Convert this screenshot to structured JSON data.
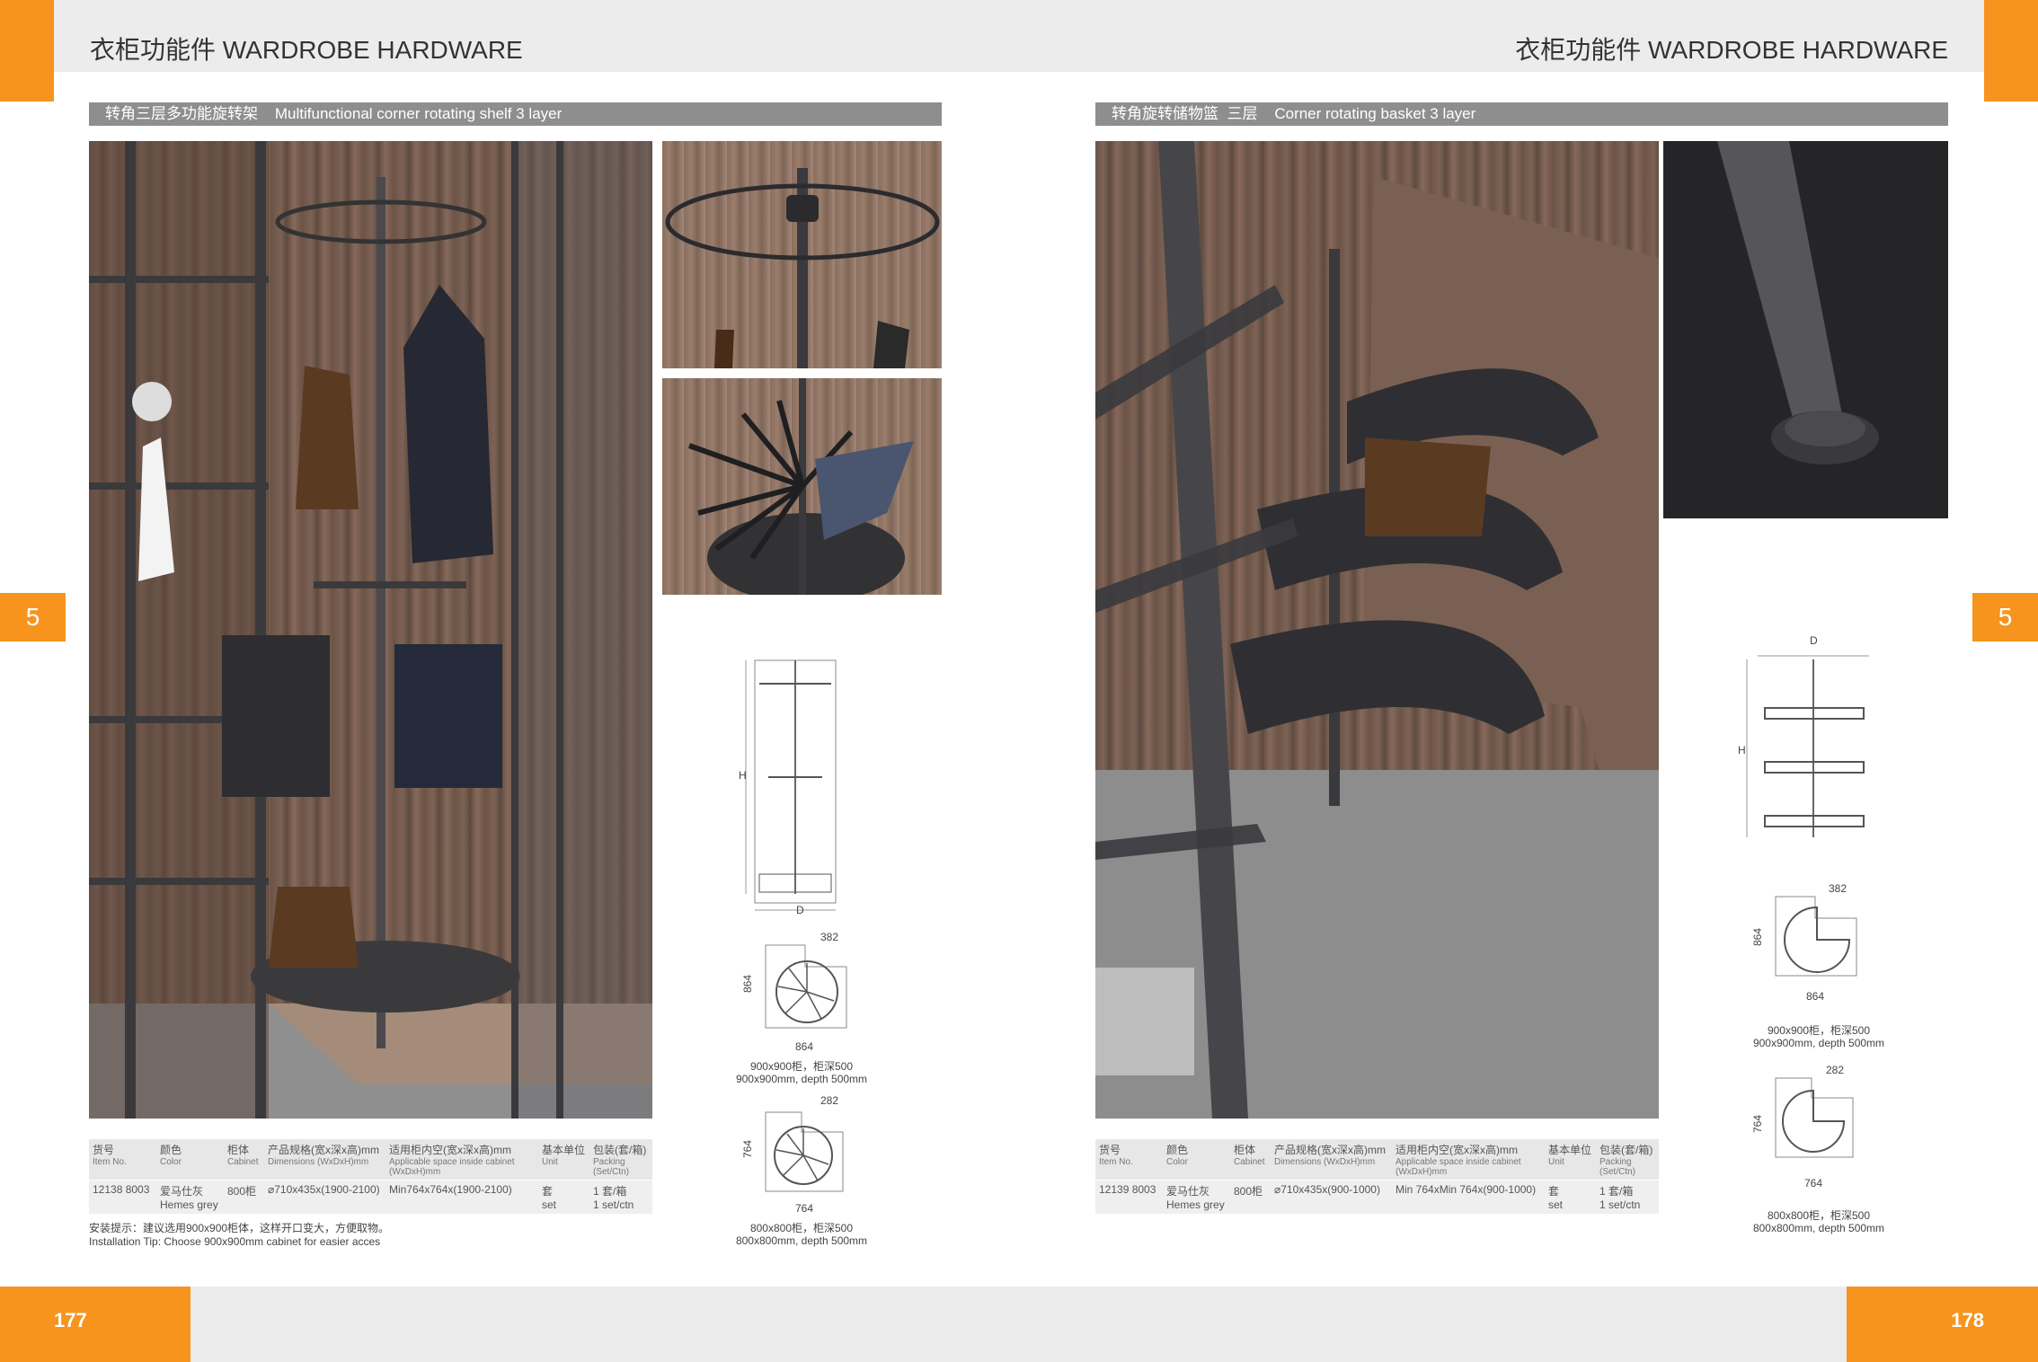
{
  "header": {
    "left_title": "衣柜功能件  WARDROBE HARDWARE",
    "right_title": "衣柜功能件  WARDROBE HARDWARE",
    "chapter_left": "5",
    "chapter_right": "5"
  },
  "left_page": {
    "product_title": "转角三层多功能旋转架    Multifunctional corner rotating shelf 3 layer",
    "table": {
      "headers": [
        {
          "cn": "货号",
          "en": "Item No."
        },
        {
          "cn": "颜色",
          "en": "Color"
        },
        {
          "cn": "柜体",
          "en": "Cabinet"
        },
        {
          "cn": "产品规格(宽x深x高)mm",
          "en": "Dimensions (WxDxH)mm"
        },
        {
          "cn": "适用柜内空(宽x深x高)mm",
          "en": "Applicable space inside cabinet (WxDxH)mm"
        },
        {
          "cn": "基本单位",
          "en": "Unit"
        },
        {
          "cn": "包装(套/箱)",
          "en": "Packing (Set/Ctn)"
        }
      ],
      "row": [
        {
          "cn": "12138 8003",
          "en": ""
        },
        {
          "cn": "爱马仕灰",
          "en": "Hemes grey"
        },
        {
          "cn": "800柜",
          "en": ""
        },
        {
          "cn": "⌀710x435x(1900-2100)",
          "en": ""
        },
        {
          "cn": "Min764x764x(1900-2100)",
          "en": ""
        },
        {
          "cn": "套",
          "en": "set"
        },
        {
          "cn": "1 套/箱",
          "en": "1 set/ctn"
        }
      ]
    },
    "install_tip_cn": "安装提示：建议选用900x900柜体，这样开口变大，方便取物。",
    "install_tip_en": "Installation Tip: Choose 900x900mm cabinet for easier acces",
    "drawing": {
      "label_h": "H",
      "label_d": "D",
      "top_dim_1": "382",
      "side_dim_1": "864",
      "bottom_dim_1": "864",
      "caption_1_cn": "900x900柜，柜深500",
      "caption_1_en": "900x900mm, depth 500mm",
      "top_dim_2": "282",
      "side_dim_2": "764",
      "bottom_dim_2": "764",
      "caption_2_cn": "800x800柜，柜深500",
      "caption_2_en": "800x800mm, depth 500mm"
    },
    "page_number": "177"
  },
  "right_page": {
    "product_title": "转角旋转储物篮  三层    Corner rotating basket 3 layer",
    "table": {
      "headers": [
        {
          "cn": "货号",
          "en": "Item No."
        },
        {
          "cn": "颜色",
          "en": "Color"
        },
        {
          "cn": "柜体",
          "en": "Cabinet"
        },
        {
          "cn": "产品规格(宽x深x高)mm",
          "en": "Dimensions (WxDxH)mm"
        },
        {
          "cn": "适用柜内空(宽x深x高)mm",
          "en": "Applicable space inside cabinet (WxDxH)mm"
        },
        {
          "cn": "基本单位",
          "en": "Unit"
        },
        {
          "cn": "包装(套/箱)",
          "en": "Packing (Set/Ctn)"
        }
      ],
      "row": [
        {
          "cn": "12139 8003",
          "en": ""
        },
        {
          "cn": "爱马仕灰",
          "en": "Hemes grey"
        },
        {
          "cn": "800柜",
          "en": ""
        },
        {
          "cn": "⌀710x435x(900-1000)",
          "en": ""
        },
        {
          "cn": "Min 764xMin 764x(900-1000)",
          "en": ""
        },
        {
          "cn": "套",
          "en": "set"
        },
        {
          "cn": "1 套/箱",
          "en": "1 set/ctn"
        }
      ]
    },
    "drawing": {
      "label_h": "H",
      "label_d": "D",
      "top_dim_1": "382",
      "side_dim_1": "864",
      "bottom_dim_1": "864",
      "caption_1_cn": "900x900柜，柜深500",
      "caption_1_en": "900x900mm, depth 500mm",
      "top_dim_2": "282",
      "side_dim_2": "764",
      "bottom_dim_2": "764",
      "caption_2_cn": "800x800柜，柜深500",
      "caption_2_en": "800x800mm, depth 500mm"
    },
    "page_number": "178"
  },
  "colors": {
    "accent": "#f7941d",
    "bar": "#8e8e8e",
    "band": "#ececec"
  }
}
